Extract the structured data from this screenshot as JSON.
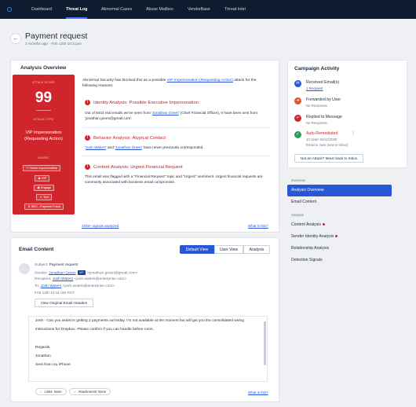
{
  "nav": {
    "logo_icon": "abnormal-logo-icon",
    "tabs": [
      "Dashboard",
      "Threat Log",
      "Abnormal Cases",
      "Abuse Mailbox",
      "VendorBase",
      "Threat Intel"
    ],
    "active_tab": "Threat Log"
  },
  "header": {
    "title": "Payment request",
    "subtitle": "2 months ago · Feb 12th 10:11am"
  },
  "analysis": {
    "heading": "Analysis Overview",
    "score_label": "ATTACK SCORE",
    "score": "99",
    "type_label": "ATTACK TYPE",
    "attack_type": "VIP Impersonation (Requesting Action)",
    "vectors_label": "VIA/BEC",
    "tags": [
      "Name Impersonation",
      "VIP",
      "Engage",
      "Text",
      "BEC - Payment Fraud"
    ],
    "intro_prefix": "Abnormal Security has blocked this as a possible ",
    "intro_link": "VIP Impersonation (Requesting Action)",
    "intro_suffix": " attack for the following reasons:",
    "reasons": [
      {
        "title": "Identity Analysis: Possible Executive Impersonation",
        "text_a": "Out of 8443 real emails we've seen from '",
        "link": "Jonathan Green",
        "text_b": "' (Chief Financial Officer), 0 have been sent from 'jonathan.green@gmail.com'."
      },
      {
        "title": "Behavior Analysis: Atypical Contact",
        "link_a": "Josh Waters",
        "text_a": "' and '",
        "link_b": "Jonathan Green",
        "text_b": "' have never previously corresponded."
      },
      {
        "title": "Content Analysis: Urgent Financial Request",
        "text": "This email was flagged with a \"Financial Request\" topic and \"Urgent\" sentiment. Urgent financial requests are commonly associated with business email compromise."
      }
    ],
    "signals_link": "1028+ signals analyzed",
    "what_link": "What is this?"
  },
  "campaign": {
    "heading": "Campaign Activity",
    "items": [
      {
        "icon": "envelope-icon",
        "color": "#2857d6",
        "title": "Received Email(s)",
        "sub": "1 Recipient",
        "sub_is_link": true
      },
      {
        "icon": "forward-icon",
        "color": "#e0562d",
        "title": "Forwarded by User",
        "sub": "No Recipients"
      },
      {
        "icon": "reply-icon",
        "color": "#d0262b",
        "title": "Replied to Message",
        "sub": "No Recipients"
      },
      {
        "icon": "check-icon",
        "color": "#2d9d57",
        "title": "Auto-Remediated",
        "sub": "10:12am 02/12/2020",
        "sub2": "Email in Junk (was in Inbox)"
      }
    ],
    "button": "Not an Attack? Move back to Inbox"
  },
  "sidenav": {
    "overview_label": "Overview",
    "overview_items": [
      "Analysis Overview",
      "Email Content"
    ],
    "active_item": "Analysis Overview",
    "analysis_label": "Analysis",
    "analysis_items": [
      {
        "label": "Content Analysis",
        "flag": true
      },
      {
        "label": "Sender Identity Analysis",
        "flag": true
      },
      {
        "label": "Relationship Analysis",
        "flag": false
      },
      {
        "label": "Detection Signals",
        "flag": false
      }
    ]
  },
  "email": {
    "heading": "Email Content",
    "views": [
      "Default View",
      "User View",
      "Analysis"
    ],
    "active_view": "Default View",
    "subject_label": "Subject:",
    "subject": "Payment request",
    "sender_label": "Sender:",
    "sender_name": "Jonathan Green",
    "sender_badge": "VIP",
    "sender_email": "<jonathan.green@gmail.com>",
    "recipient_label": "Recipient:",
    "recipient_name": "Josh Waters",
    "recipient_email": "<josh.waters@enterprise.com>",
    "to_label": "To:",
    "to_name": "Josh Waters",
    "to_email": "<josh.waters@enterprise.com>",
    "date": "Feb 12th 10:11 AM PST",
    "headers_button": "View Original Email Headers",
    "body": [
      "Josh - Can you assist in getting 2 payments out today. I'm not available at the moment but will get you the consolidated wiring",
      "instructions for Dropbox. Please confirm if you can handle before noon.",
      "Regards,",
      "Jonathan",
      "Sent from my iPhone"
    ],
    "tags": [
      "Links: None",
      "Attachments: None"
    ],
    "what_link": "What is this?"
  }
}
